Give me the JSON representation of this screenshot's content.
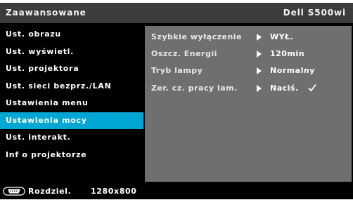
{
  "header": {
    "title": "Zaawansowane",
    "model": "Dell S500wi"
  },
  "menu": {
    "selected_index": 5,
    "items": [
      {
        "label": "Ust. obrazu"
      },
      {
        "label": "Ust. wyświetl."
      },
      {
        "label": "Ust. projektora"
      },
      {
        "label": "Ust. sieci bezprz./LAN"
      },
      {
        "label": "Ustawienia menu"
      },
      {
        "label": "Ustawienia mocy"
      },
      {
        "label": "Ust. interakt."
      },
      {
        "label": "Inf o projektorze"
      }
    ]
  },
  "panel": {
    "rows": [
      {
        "label": "Szybkie wyłączenie",
        "value": "WYŁ."
      },
      {
        "label": "Oszcz. Energii",
        "value": "120min"
      },
      {
        "label": "Tryb lampy",
        "value": "Normalny"
      },
      {
        "label": "Zer. cz. pracy lam.",
        "value": "Naciś.",
        "confirm_icon": "check-icon"
      }
    ]
  },
  "footer": {
    "input_icon": "vga-connector-icon",
    "label": "Rozdziel.",
    "resolution": "1280x800"
  },
  "colors": {
    "osd_background": "#000000",
    "header_background": "#3c3c3c",
    "selected_item": "#00a6d4",
    "panel_background": "#6f6f6f",
    "text": "#ffffff"
  }
}
